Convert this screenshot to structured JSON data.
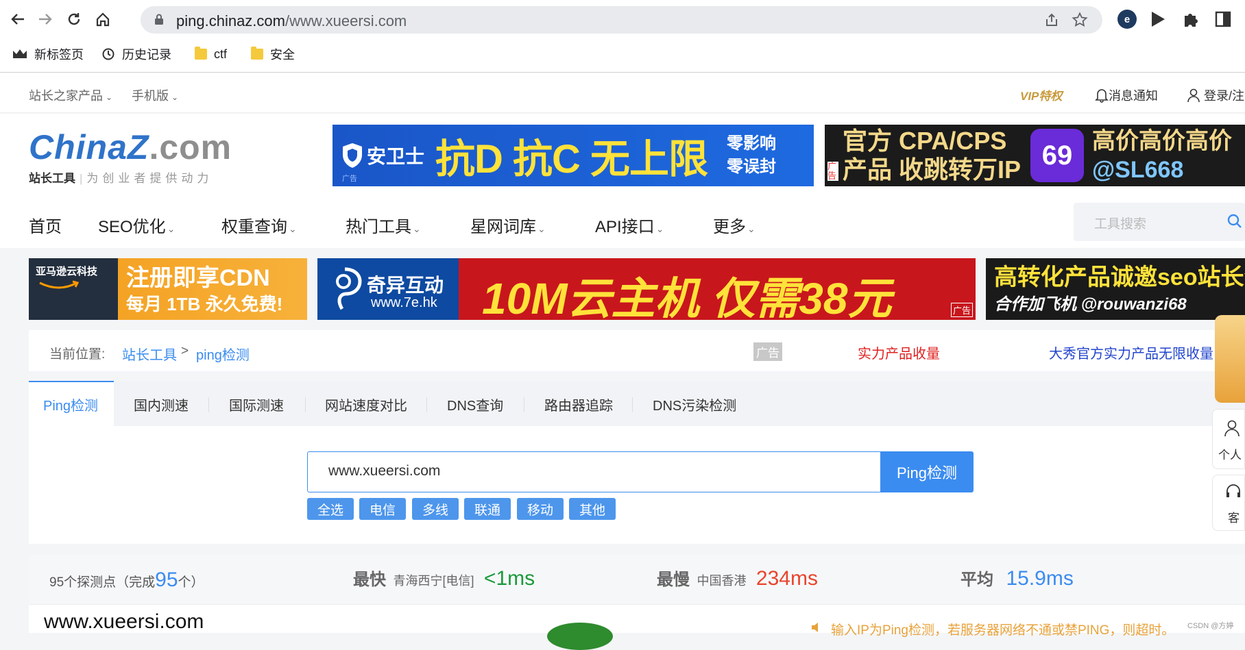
{
  "browser": {
    "url_host": "ping.chinaz.com",
    "url_path": "/www.xueersi.com",
    "bookmarks": [
      "新标签页",
      "历史记录",
      "ctf",
      "安全"
    ]
  },
  "topbar": {
    "products": "站长之家产品",
    "mobile": "手机版",
    "vip": "VIP特权",
    "notifications": "消息通知",
    "login": "登录/注"
  },
  "logo": {
    "main": "ChinaZ",
    "domain": ".com",
    "name": "站长工具",
    "slogan": "为创业者提供动力"
  },
  "ads": {
    "anweishi_brand": "安卫士",
    "anweishi_main": "抗D 抗C 无上限",
    "anweishi_side1": "零影响",
    "anweishi_side2": "零误封",
    "cpa_line1": "官方 CPA/CPS",
    "cpa_line2": "产品 收跳转万IP",
    "cpa_right1": "高价高价高价",
    "cpa_right2": "@SL668",
    "amazon_brand": "亚马逊云科技",
    "amazon_line1": "注册即享CDN",
    "amazon_line2": "每月 1TB 永久免费!",
    "qiyi_brand": "奇异互动",
    "qiyi_url": "www.7e.hk",
    "qiyi_main": "10M云主机 仅需38元",
    "seo_line1": "高转化产品诚邀seo站长合作",
    "seo_line2": "合作加飞机 @rouwanzi68",
    "ad_tag": "广告"
  },
  "mainnav": {
    "items": [
      "首页",
      "SEO优化",
      "权重查询",
      "热门工具",
      "星网词库",
      "API接口",
      "更多"
    ],
    "search_placeholder": "工具搜索"
  },
  "breadcrumb": {
    "prefix": "当前位置:",
    "root": "站长工具",
    "sep": ">",
    "current": "ping检测",
    "ad_tag": "广告",
    "ad1": "实力产品收量",
    "ad2": "大秀官方实力产品无限收量"
  },
  "tabs": [
    "Ping检测",
    "国内测速",
    "国际测速",
    "网站速度对比",
    "DNS查询",
    "路由器追踪",
    "DNS污染检测"
  ],
  "ping": {
    "input_value": "www.xueersi.com",
    "button": "Ping检测",
    "filters": [
      "全选",
      "电信",
      "多线",
      "联通",
      "移动",
      "其他"
    ]
  },
  "stats": {
    "points_prefix": "95个探测点（完成",
    "points_done": "95",
    "points_suffix": "个）",
    "fastest_label": "最快",
    "fastest_loc": "青海西宁[电信]",
    "fastest_val": "<1ms",
    "slowest_label": "最慢",
    "slowest_loc": "中国香港",
    "slowest_val": "234ms",
    "avg_label": "平均",
    "avg_val": "15.9ms"
  },
  "result": {
    "domain": "www.xueersi.com",
    "tip": "输入IP为Ping检测，若服务器网络不通或禁PING，则超时。",
    "watermark": "CSDN @方婷"
  },
  "side": {
    "personal": "个人",
    "service": "客"
  },
  "colors": {
    "accent": "#3b8cf0",
    "fast": "#1a9a3a",
    "slow": "#e8452c",
    "avg": "#3b8cf0"
  }
}
